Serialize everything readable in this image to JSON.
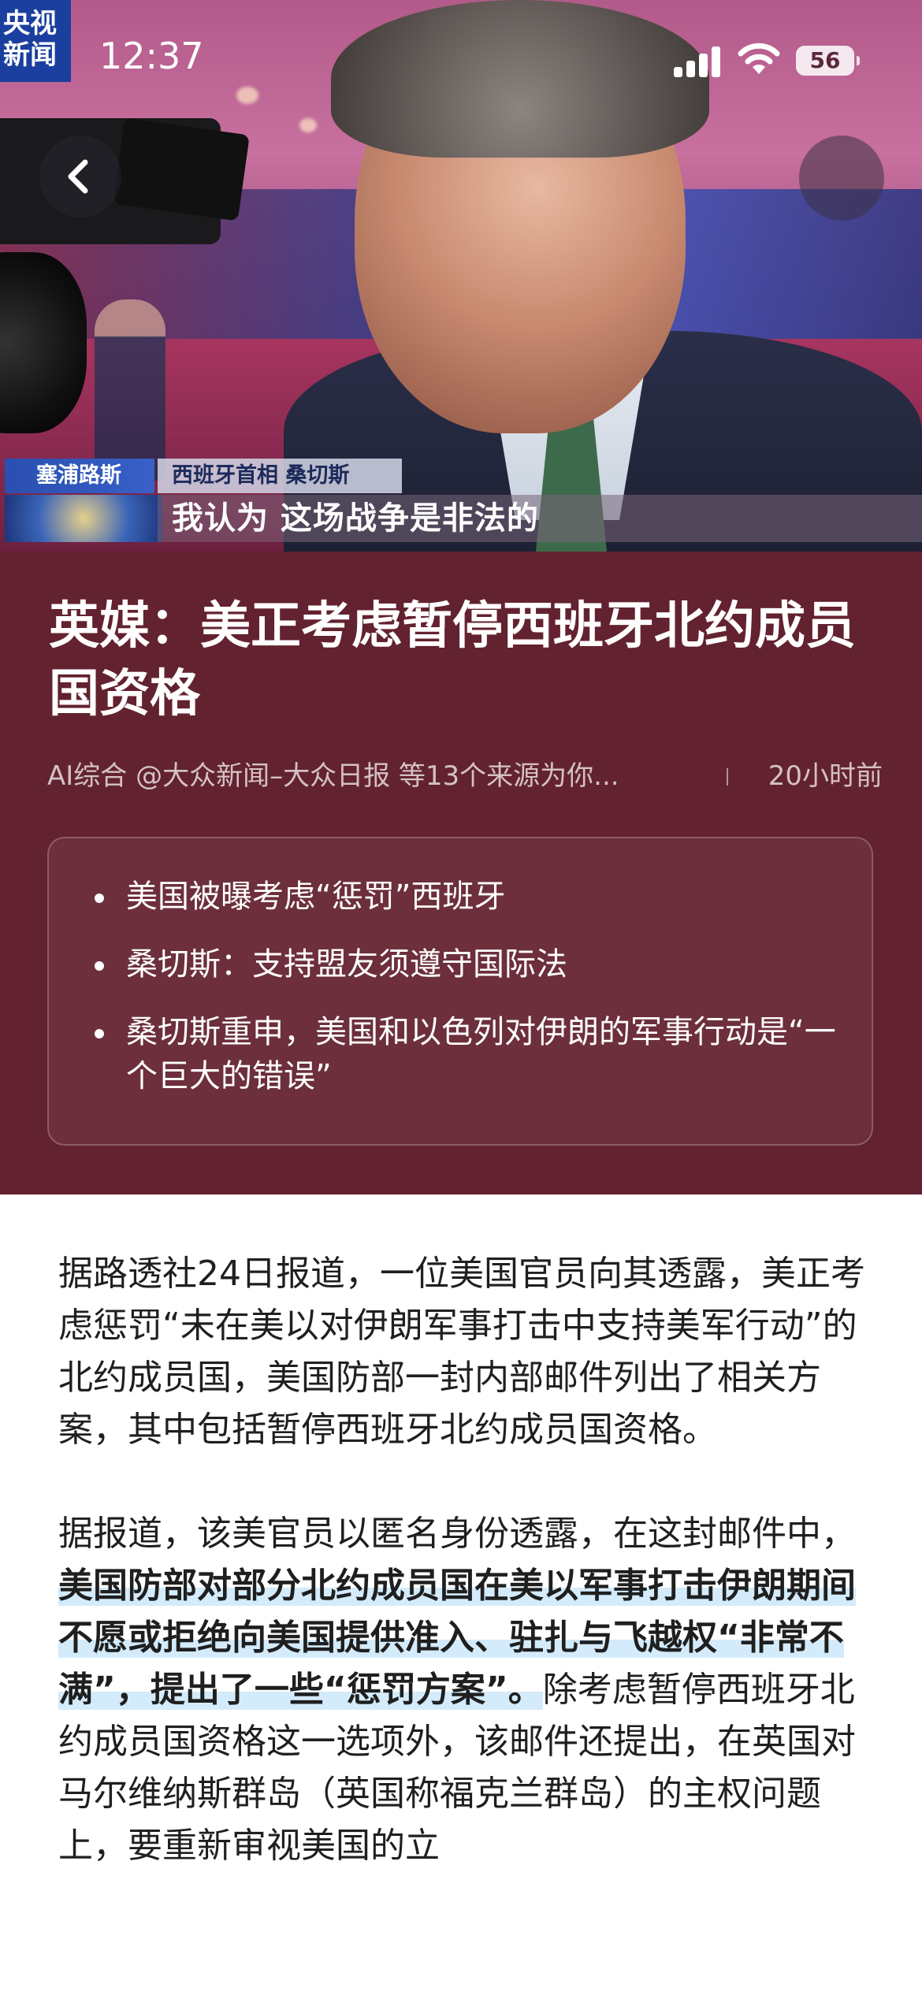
{
  "logo": {
    "line1": "央视",
    "line2": "新闻"
  },
  "status_bar": {
    "time": "12:37",
    "battery": "56"
  },
  "hero": {
    "caption_location": "塞浦路斯",
    "caption_name": "西班牙首相 桑切斯",
    "caption_quote": "我认为 这场战争是非法的"
  },
  "article": {
    "title": "英媒：美正考虑暂停西班牙北约成员国资格",
    "source": "AI综合 @大众新闻–大众日报 等13个来源为你...",
    "time_ago": "20小时前",
    "summary": [
      "美国被曝考虑“惩罚”西班牙",
      "桑切斯：支持盟友须遵守国际法",
      "桑切斯重申，美国和以色列对伊朗的军事行动是“一个巨大的错误”"
    ],
    "p1": "据路透社24日报道，一位美国官员向其透露，美正考虑惩罚“未在美以对伊朗军事打击中支持美军行动”的北约成员国，美国防部一封内部邮件列出了相关方案，其中包括暂停西班牙北约成员国资格。",
    "p2_start": "据报道，该美官员以匿名身份透露，在这封邮件中，",
    "p2_highlight": "美国防部对部分北约成员国在美以军事打击伊朗期间不愿或拒绝向美国提供准入、驻扎与飞越权“非常不满”，提出了一些“惩罚方案”。",
    "p2_end": "除考虑暂停西班牙北约成员国资格这一选项外，该邮件还提出，在英国对马尔维纳斯群岛（英国称福克兰群岛）的主权问题上，要重新审视美国的立"
  },
  "colors": {
    "panel": "#63222f",
    "highlight": "#d3ebfb"
  },
  "icons": {
    "back": "chevron-left-icon",
    "signal": "cellular-signal-icon",
    "wifi": "wifi-icon",
    "battery": "battery-icon"
  }
}
